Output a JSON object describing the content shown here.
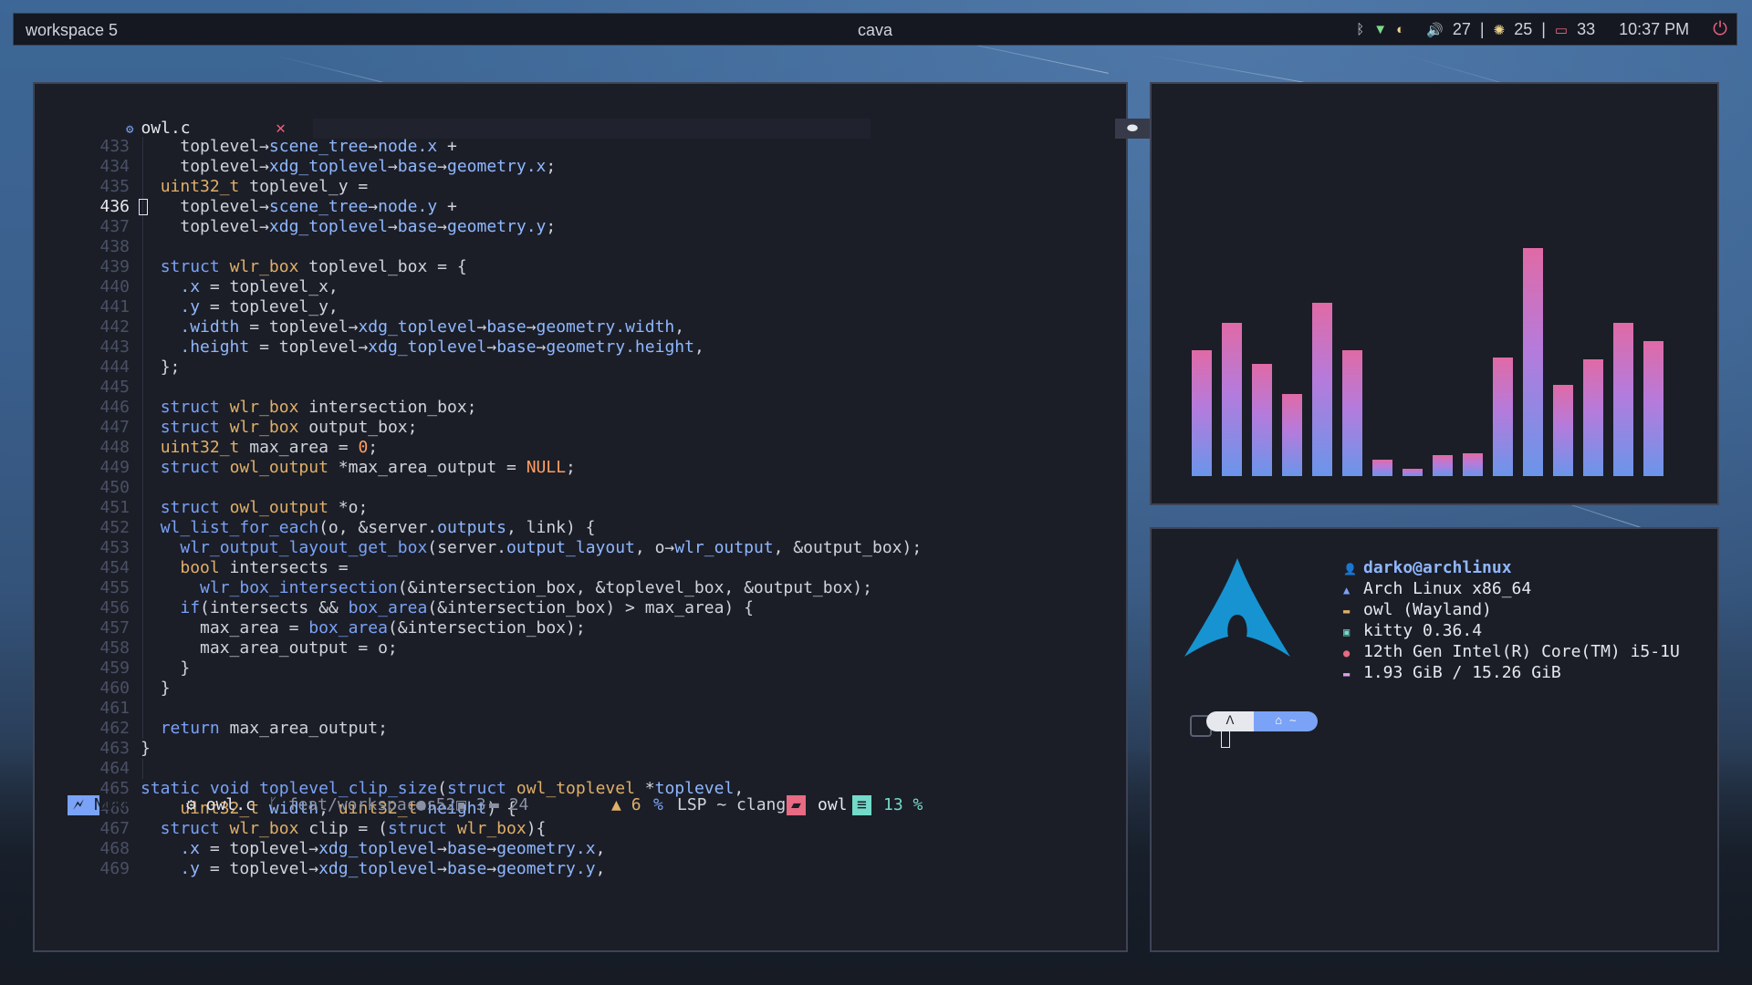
{
  "colors": {
    "keyword": "#7aa2f7",
    "type": "#e0af68",
    "field": "#8fb7ff",
    "number": "#ff9e64",
    "text": "#cfd3dc",
    "accent_pink": "#e86a83",
    "accent_teal": "#73daca"
  },
  "topbar": {
    "workspace": "workspace 5",
    "title": "cava",
    "volume": "27",
    "brightness": "25",
    "battery": "33",
    "time": "10:37 PM",
    "sep": "|",
    "icons": [
      "bluetooth-icon",
      "wifi-icon",
      "moon-icon",
      "volume-icon",
      "brightness-icon",
      "battery-icon",
      "power-icon"
    ]
  },
  "editor": {
    "tab": {
      "filename": "owl.c",
      "close": "✕"
    },
    "lines": [
      {
        "n": "433",
        "segs": [
          [
            "  toplevel",
            "t"
          ],
          [
            "→",
            "t"
          ],
          [
            "scene_tree",
            "f"
          ],
          [
            "→",
            "t"
          ],
          [
            "node",
            "f"
          ],
          [
            ".x",
            "f"
          ],
          [
            " +",
            "t"
          ]
        ]
      },
      {
        "n": "434",
        "segs": [
          [
            "  toplevel",
            "t"
          ],
          [
            "→",
            "t"
          ],
          [
            "xdg_toplevel",
            "f"
          ],
          [
            "→",
            "t"
          ],
          [
            "base",
            "f"
          ],
          [
            "→",
            "t"
          ],
          [
            "geometry",
            "f"
          ],
          [
            ".x",
            "f"
          ],
          [
            ";",
            "t"
          ]
        ]
      },
      {
        "n": "435",
        "segs": [
          [
            "uint32_t",
            "y"
          ],
          [
            " toplevel_y =",
            "t"
          ]
        ]
      },
      {
        "n": "436",
        "cur": true,
        "segs": [
          [
            "  toplevel",
            "t"
          ],
          [
            "→",
            "t"
          ],
          [
            "scene_tree",
            "f"
          ],
          [
            "→",
            "t"
          ],
          [
            "node",
            "f"
          ],
          [
            ".y",
            "f"
          ],
          [
            " +",
            "t"
          ]
        ]
      },
      {
        "n": "437",
        "segs": [
          [
            "  toplevel",
            "t"
          ],
          [
            "→",
            "t"
          ],
          [
            "xdg_toplevel",
            "f"
          ],
          [
            "→",
            "t"
          ],
          [
            "base",
            "f"
          ],
          [
            "→",
            "t"
          ],
          [
            "geometry",
            "f"
          ],
          [
            ".y",
            "f"
          ],
          [
            ";",
            "t"
          ]
        ]
      },
      {
        "n": "438",
        "segs": []
      },
      {
        "n": "439",
        "segs": [
          [
            "struct",
            "k"
          ],
          [
            " ",
            "t"
          ],
          [
            "wlr_box",
            "y"
          ],
          [
            " toplevel_box = {",
            "t"
          ]
        ]
      },
      {
        "n": "440",
        "segs": [
          [
            "  .x",
            "f"
          ],
          [
            " = toplevel_x,",
            "t"
          ]
        ]
      },
      {
        "n": "441",
        "segs": [
          [
            "  .y",
            "f"
          ],
          [
            " = toplevel_y,",
            "t"
          ]
        ]
      },
      {
        "n": "442",
        "segs": [
          [
            "  .width",
            "f"
          ],
          [
            " = toplevel",
            "t"
          ],
          [
            "→",
            "t"
          ],
          [
            "xdg_toplevel",
            "f"
          ],
          [
            "→",
            "t"
          ],
          [
            "base",
            "f"
          ],
          [
            "→",
            "t"
          ],
          [
            "geometry",
            "f"
          ],
          [
            ".width",
            "f"
          ],
          [
            ",",
            "t"
          ]
        ]
      },
      {
        "n": "443",
        "segs": [
          [
            "  .height",
            "f"
          ],
          [
            " = toplevel",
            "t"
          ],
          [
            "→",
            "t"
          ],
          [
            "xdg_toplevel",
            "f"
          ],
          [
            "→",
            "t"
          ],
          [
            "base",
            "f"
          ],
          [
            "→",
            "t"
          ],
          [
            "geometry",
            "f"
          ],
          [
            ".height",
            "f"
          ],
          [
            ",",
            "t"
          ]
        ]
      },
      {
        "n": "444",
        "segs": [
          [
            "};",
            "t"
          ]
        ]
      },
      {
        "n": "445",
        "segs": []
      },
      {
        "n": "446",
        "segs": [
          [
            "struct",
            "k"
          ],
          [
            " ",
            "t"
          ],
          [
            "wlr_box",
            "y"
          ],
          [
            " intersection_box;",
            "t"
          ]
        ]
      },
      {
        "n": "447",
        "segs": [
          [
            "struct",
            "k"
          ],
          [
            " ",
            "t"
          ],
          [
            "wlr_box",
            "y"
          ],
          [
            " output_box;",
            "t"
          ]
        ]
      },
      {
        "n": "448",
        "segs": [
          [
            "uint32_t",
            "y"
          ],
          [
            " max_area = ",
            "t"
          ],
          [
            "0",
            "n"
          ],
          [
            ";",
            "t"
          ]
        ]
      },
      {
        "n": "449",
        "segs": [
          [
            "struct",
            "k"
          ],
          [
            " ",
            "t"
          ],
          [
            "owl_output",
            "y"
          ],
          [
            " *max_area_output = ",
            "t"
          ],
          [
            "NULL",
            "n"
          ],
          [
            ";",
            "t"
          ]
        ]
      },
      {
        "n": "450",
        "segs": []
      },
      {
        "n": "451",
        "segs": [
          [
            "struct",
            "k"
          ],
          [
            " ",
            "t"
          ],
          [
            "owl_output",
            "y"
          ],
          [
            " *o;",
            "t"
          ]
        ]
      },
      {
        "n": "452",
        "segs": [
          [
            "wl_list_for_each",
            "k"
          ],
          [
            "(o, &server.",
            "t"
          ],
          [
            "outputs",
            "f"
          ],
          [
            ", link) {",
            "t"
          ]
        ]
      },
      {
        "n": "453",
        "segs": [
          [
            "  wlr_output_layout_get_box",
            "k"
          ],
          [
            "(server.",
            "t"
          ],
          [
            "output_layout",
            "f"
          ],
          [
            ", o",
            "t"
          ],
          [
            "→",
            "t"
          ],
          [
            "wlr_output",
            "f"
          ],
          [
            ", &output_box);",
            "t"
          ]
        ]
      },
      {
        "n": "454",
        "segs": [
          [
            "  bool",
            "y"
          ],
          [
            " intersects =",
            "t"
          ]
        ]
      },
      {
        "n": "455",
        "segs": [
          [
            "    wlr_box_intersection",
            "k"
          ],
          [
            "(&intersection_box, &toplevel_box, &output_box);",
            "t"
          ]
        ]
      },
      {
        "n": "456",
        "segs": [
          [
            "  if",
            "k"
          ],
          [
            "(intersects && ",
            "t"
          ],
          [
            "box_area",
            "k"
          ],
          [
            "(&intersection_box) > max_area) {",
            "t"
          ]
        ]
      },
      {
        "n": "457",
        "segs": [
          [
            "    max_area = ",
            "t"
          ],
          [
            "box_area",
            "k"
          ],
          [
            "(&intersection_box);",
            "t"
          ]
        ]
      },
      {
        "n": "458",
        "segs": [
          [
            "    max_area_output = o;",
            "t"
          ]
        ]
      },
      {
        "n": "459",
        "segs": [
          [
            "  }",
            "t"
          ]
        ]
      },
      {
        "n": "460",
        "segs": [
          [
            "}",
            "t"
          ]
        ]
      },
      {
        "n": "461",
        "segs": []
      },
      {
        "n": "462",
        "segs": [
          [
            "return",
            "k"
          ],
          [
            " max_area_output;",
            "t"
          ]
        ]
      },
      {
        "n": "463",
        "segs": [
          [
            "}",
            "t"
          ]
        ],
        "outer": true
      },
      {
        "n": "464",
        "segs": []
      },
      {
        "n": "465",
        "segs": [
          [
            "static",
            "k"
          ],
          [
            " ",
            "t"
          ],
          [
            "void",
            "k"
          ],
          [
            " ",
            "t"
          ],
          [
            "toplevel_clip_size",
            "k"
          ],
          [
            "(",
            "t"
          ],
          [
            "struct",
            "k"
          ],
          [
            " ",
            "t"
          ],
          [
            "owl_toplevel",
            "y"
          ],
          [
            " *",
            "t"
          ],
          [
            "toplevel",
            "f"
          ],
          [
            ",",
            "t"
          ]
        ],
        "outer": true
      },
      {
        "n": "466",
        "segs": [
          [
            "    uint32_t",
            "y"
          ],
          [
            " ",
            "t"
          ],
          [
            "width",
            "f"
          ],
          [
            ", ",
            "t"
          ],
          [
            "uint32_t",
            "y"
          ],
          [
            " ",
            "t"
          ],
          [
            "height",
            "f"
          ],
          [
            ") {",
            "t"
          ]
        ],
        "outer": true
      },
      {
        "n": "467",
        "segs": [
          [
            "  struct",
            "k"
          ],
          [
            " ",
            "t"
          ],
          [
            "wlr_box",
            "y"
          ],
          [
            " clip = (",
            "t"
          ],
          [
            "struct",
            "k"
          ],
          [
            " ",
            "t"
          ],
          [
            "wlr_box",
            "y"
          ],
          [
            "){",
            "t"
          ]
        ],
        "outer": true
      },
      {
        "n": "468",
        "segs": [
          [
            "    .x",
            "f"
          ],
          [
            " = toplevel",
            "t"
          ],
          [
            "→",
            "t"
          ],
          [
            "xdg_toplevel",
            "f"
          ],
          [
            "→",
            "t"
          ],
          [
            "base",
            "f"
          ],
          [
            "→",
            "t"
          ],
          [
            "geometry",
            "f"
          ],
          [
            ".x",
            "f"
          ],
          [
            ",",
            "t"
          ]
        ],
        "outer": true
      },
      {
        "n": "469",
        "segs": [
          [
            "    .y",
            "f"
          ],
          [
            " = toplevel",
            "t"
          ],
          [
            "→",
            "t"
          ],
          [
            "xdg_toplevel",
            "f"
          ],
          [
            "→",
            "t"
          ],
          [
            "base",
            "f"
          ],
          [
            "→",
            "t"
          ],
          [
            "geometry",
            "f"
          ],
          [
            ".y",
            "f"
          ],
          [
            ",",
            "t"
          ]
        ],
        "outer": true
      }
    ],
    "status": {
      "mode": "NORMAL",
      "file": "owl.c",
      "branch": "feat/workspaces",
      "added": "52",
      "changed": "3",
      "removed": "24",
      "warnings": "6",
      "percent_sym": "%",
      "lsp": "LSP ~ clangd",
      "project": "owl",
      "progress": "13 %"
    }
  },
  "cava": {
    "levels": [
      0.55,
      0.67,
      0.49,
      0.36,
      0.76,
      0.55,
      0.07,
      0.03,
      0.09,
      0.1,
      0.52,
      1.0,
      0.4,
      0.51,
      0.67,
      0.59
    ]
  },
  "fetch": {
    "user": "darko@archlinux",
    "os": "Arch Linux x86_64",
    "wm": "owl (Wayland)",
    "terminal": "kitty 0.36.4",
    "cpu": "12th Gen Intel(R) Core(TM) i5-1U",
    "memory": "1.93 GiB / 15.26 GiB",
    "prompt_seg1": "ᐱ",
    "prompt_seg2": "⌂ ~"
  }
}
